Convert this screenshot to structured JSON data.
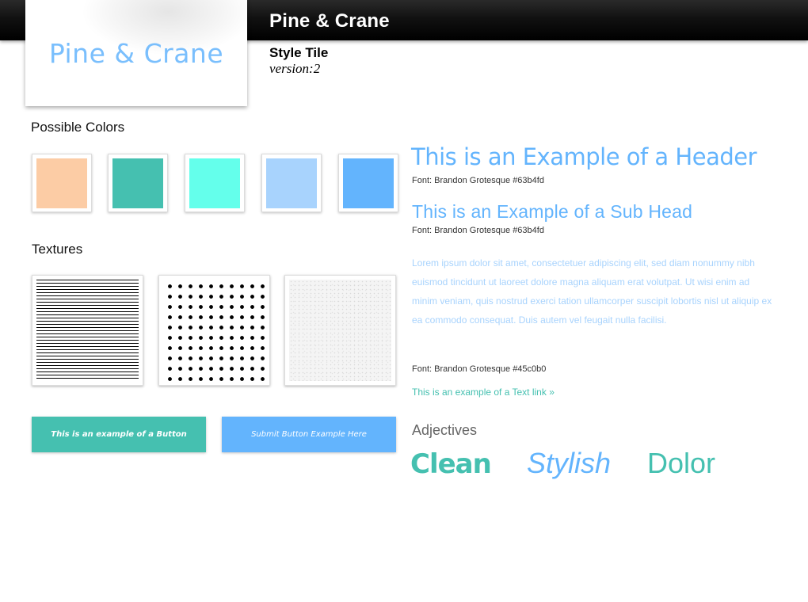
{
  "topbar": {
    "title": "Pine & Crane"
  },
  "logo": {
    "text": "Pine & Crane"
  },
  "tile": {
    "title": "Style Tile",
    "version": "version:2"
  },
  "colors": {
    "label": "Possible Colors",
    "swatches": [
      "#fccca5",
      "#45c0b0",
      "#64ffeb",
      "#a8d3fd",
      "#63b4fd"
    ]
  },
  "textures": {
    "label": "Textures",
    "items": [
      "lines",
      "dots",
      "noise"
    ]
  },
  "buttons": {
    "primary": "This is an example of a Button",
    "submit": "Submit Button Example Here"
  },
  "typography": {
    "header": "This is an Example of a Header",
    "header_font": "Font: Brandon Grotesque #63b4fd",
    "subhead": "This is an Example of a Sub Head",
    "subhead_font": "Font: Brandon Grotesque #63b4fd",
    "body": "Lorem ipsum dolor sit amet, consectetuer adipiscing elit, sed diam nonummy nibh euismod tincidunt ut laoreet dolore magna aliquam erat volutpat. Ut wisi enim ad minim veniam, quis nostrud exerci tation ullamcorper suscipit lobortis nisl ut aliquip ex ea commodo consequat. Duis autem vel feugait nulla facilisi.",
    "body_font": "Font: Brandon Grotesque #45c0b0",
    "link": "This is an example of a Text link »"
  },
  "adjectives": {
    "label": "Adjectives",
    "words": [
      "Clean",
      "Stylish",
      "Dolor"
    ]
  }
}
